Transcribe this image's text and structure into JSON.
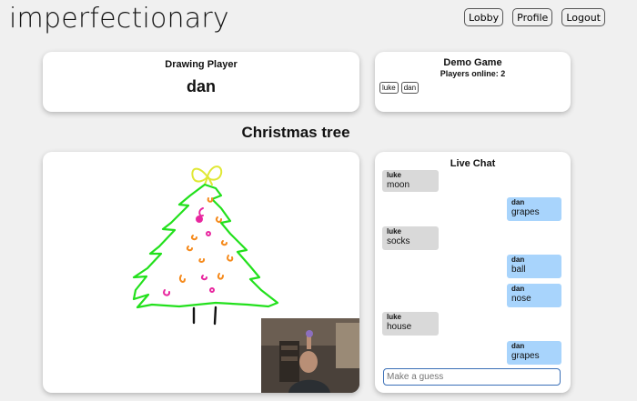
{
  "app": {
    "logo": "imperfectionary"
  },
  "nav": {
    "lobby": "Lobby",
    "profile": "Profile",
    "logout": "Logout"
  },
  "drawing_player": {
    "title": "Drawing Player",
    "name": "dan"
  },
  "game": {
    "title": "Demo Game",
    "players_online": "Players online: 2",
    "players": [
      "luke",
      "dan"
    ]
  },
  "word": "Christmas tree",
  "chat": {
    "title": "Live Chat",
    "messages": [
      {
        "user": "luke",
        "text": "moon",
        "mine": false
      },
      {
        "user": "dan",
        "text": "grapes",
        "mine": true
      },
      {
        "user": "luke",
        "text": "socks",
        "mine": false
      },
      {
        "user": "dan",
        "text": "ball",
        "mine": true
      },
      {
        "user": "dan",
        "text": "nose",
        "mine": true
      },
      {
        "user": "luke",
        "text": "house",
        "mine": false
      },
      {
        "user": "dan",
        "text": "grapes",
        "mine": true
      }
    ],
    "input_placeholder": "Make a guess"
  },
  "colors": {
    "tree": "#22e01c",
    "star": "#e0e835",
    "ornament_pink": "#e8279f",
    "ornament_orange": "#f58a1c",
    "trunk": "#111111",
    "my_message": "#a8d4fc",
    "other_message": "#d9d9d9",
    "input_border": "#3a6fb7"
  }
}
